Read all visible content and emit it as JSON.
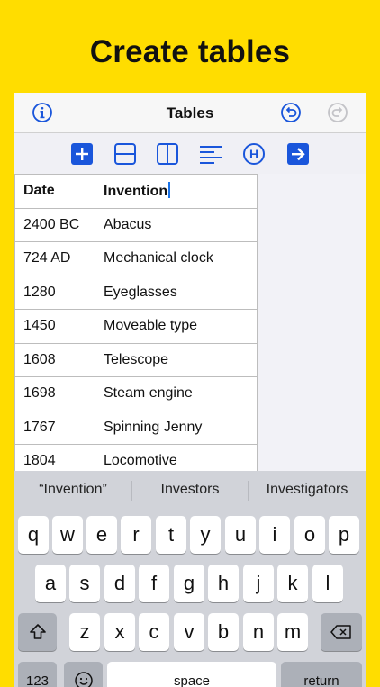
{
  "promo": {
    "headline": "Create tables"
  },
  "nav": {
    "title": "Tables"
  },
  "toolbar": {
    "buttons": [
      "add-icon",
      "insert-row-icon",
      "insert-column-icon",
      "align-icon",
      "header-icon",
      "next-cell-icon"
    ]
  },
  "table": {
    "rows": [
      [
        "Date",
        "Invention"
      ],
      [
        "2400 BC",
        "Abacus"
      ],
      [
        "724 AD",
        "Mechanical clock"
      ],
      [
        "1280",
        "Eyeglasses"
      ],
      [
        "1450",
        "Moveable type"
      ],
      [
        "1608",
        "Telescope"
      ],
      [
        "1698",
        "Steam engine"
      ],
      [
        "1767",
        "Spinning Jenny"
      ],
      [
        "1804",
        "Locomotive"
      ]
    ]
  },
  "keyboard": {
    "suggestions": [
      "“Invention”",
      "Investors",
      "Investigators"
    ],
    "row1": [
      "q",
      "w",
      "e",
      "r",
      "t",
      "y",
      "u",
      "i",
      "o",
      "p"
    ],
    "row2": [
      "a",
      "s",
      "d",
      "f",
      "g",
      "h",
      "j",
      "k",
      "l"
    ],
    "row3": [
      "z",
      "x",
      "c",
      "v",
      "b",
      "n",
      "m"
    ],
    "numbers_key": "123",
    "space_key": "space",
    "return_key": "return"
  },
  "colors": {
    "background": "#FFDD00",
    "accent": "#1A56DB"
  }
}
